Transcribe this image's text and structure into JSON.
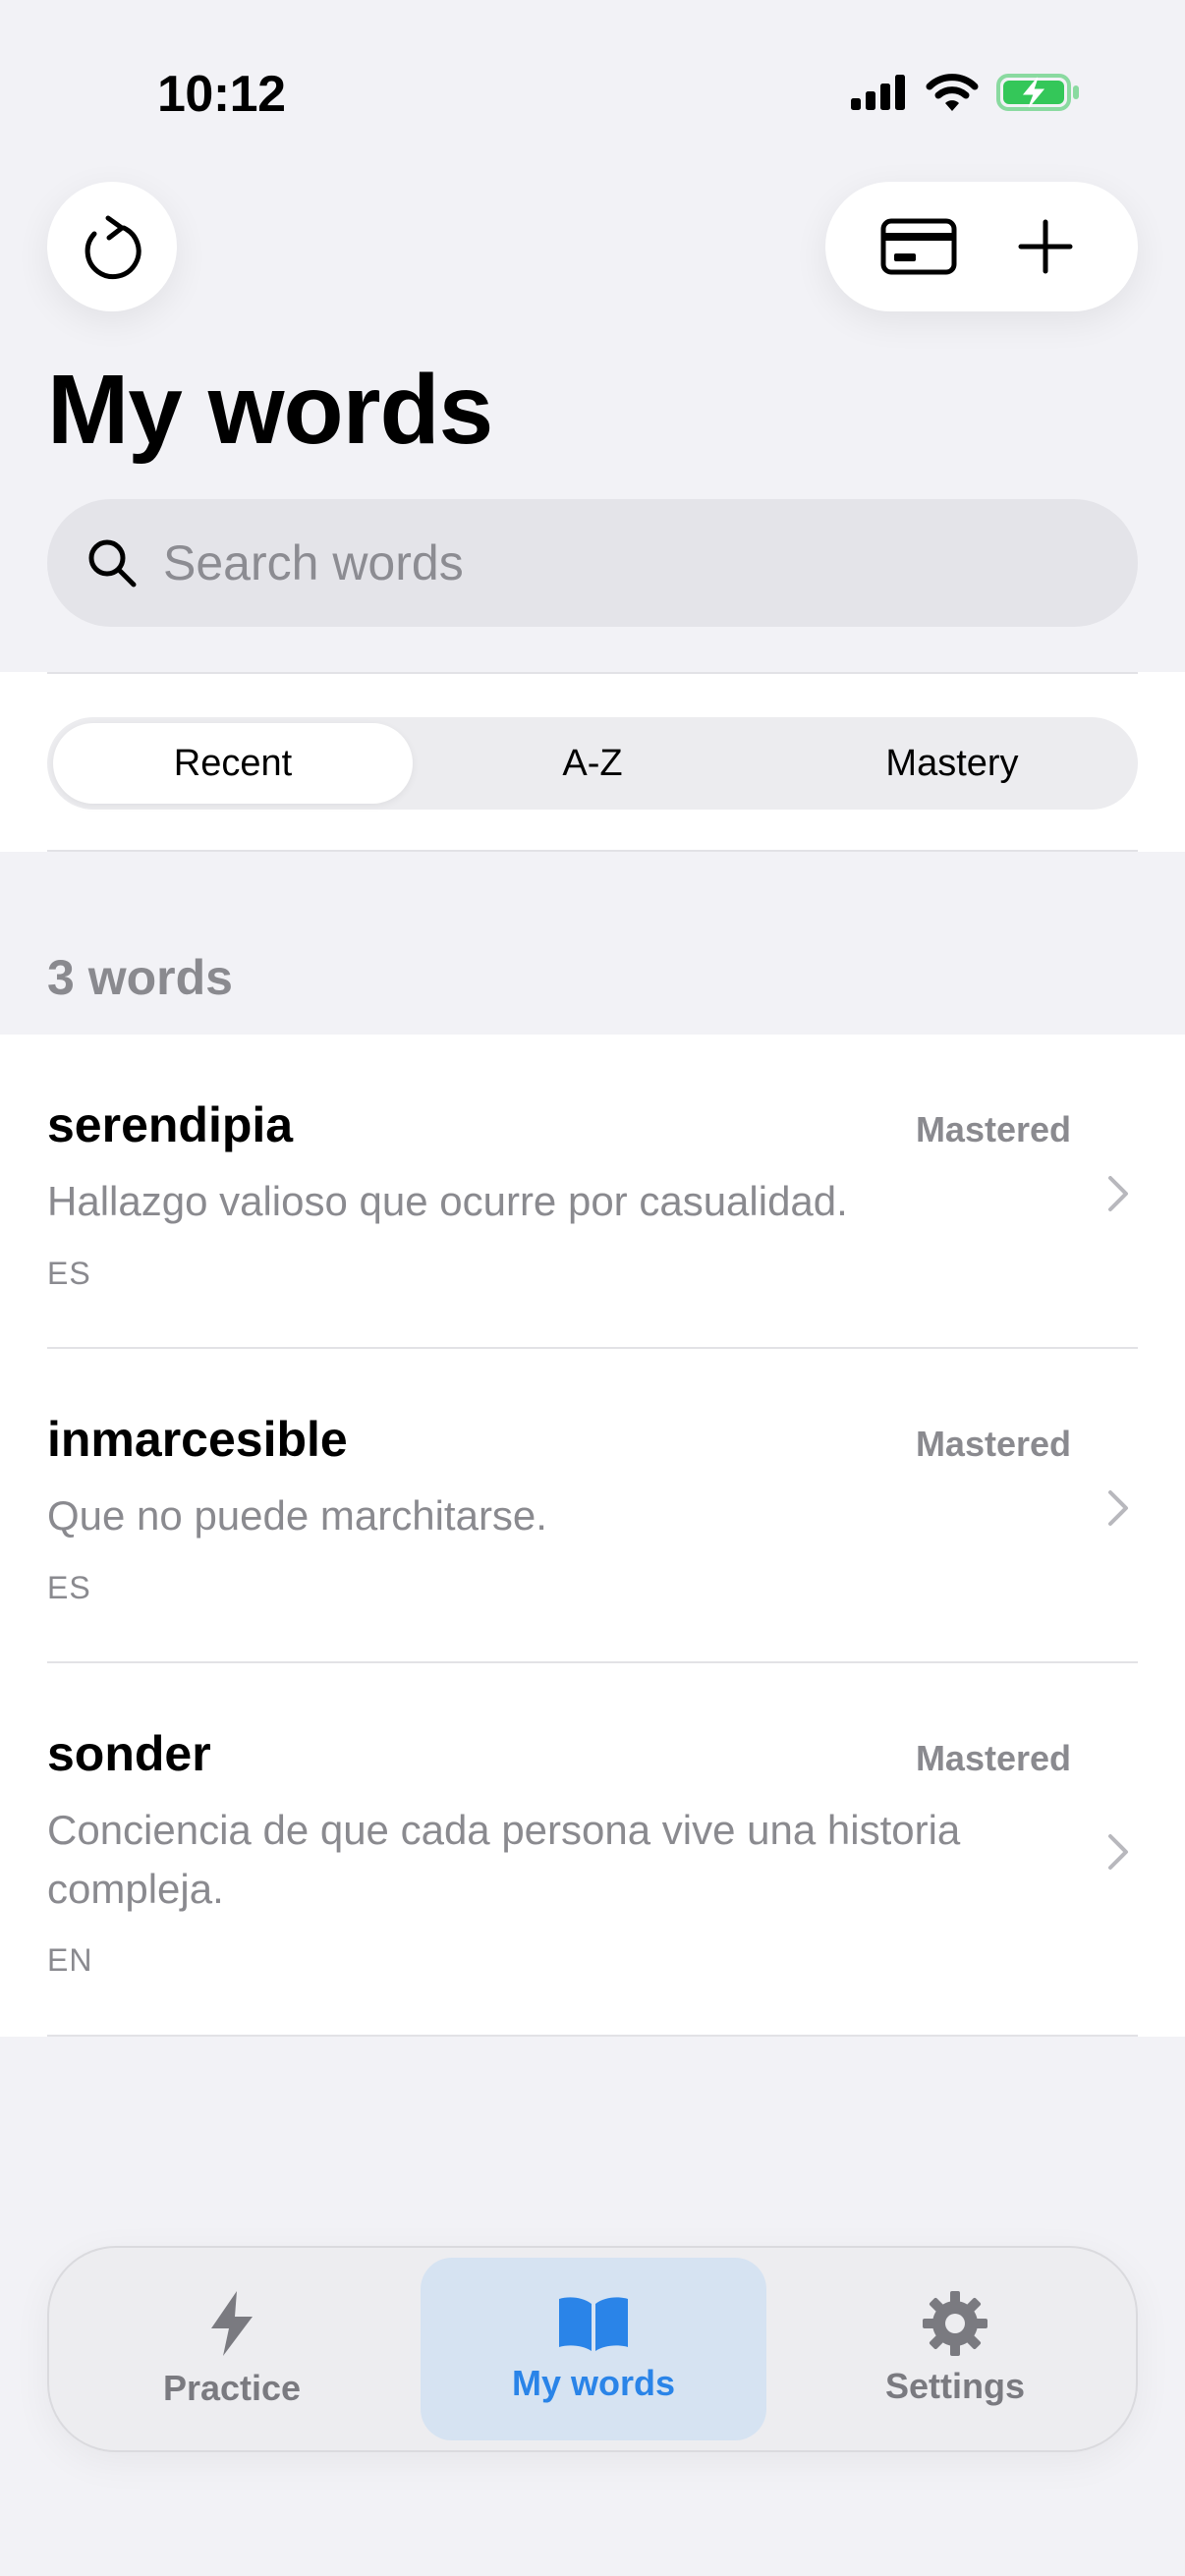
{
  "status_bar": {
    "time": "10:12"
  },
  "header": {
    "refresh_icon": "refresh-icon",
    "card_icon": "credit-card-icon",
    "add_icon": "plus-icon",
    "title": "My words"
  },
  "search": {
    "placeholder": "Search words",
    "value": ""
  },
  "sort": {
    "options": [
      "Recent",
      "A-Z",
      "Mastery"
    ],
    "selected": "Recent"
  },
  "count_label": "3 words",
  "words": [
    {
      "word": "serendipia",
      "status": "Mastered",
      "definition": "Hallazgo valioso que ocurre por casualidad.",
      "lang": "ES"
    },
    {
      "word": "inmarcesible",
      "status": "Mastered",
      "definition": "Que no puede marchitarse.",
      "lang": "ES"
    },
    {
      "word": "sonder",
      "status": "Mastered",
      "definition": "Conciencia de que cada persona vive una historia compleja.",
      "lang": "EN"
    }
  ],
  "tab_bar": {
    "tabs": [
      {
        "label": "Practice",
        "icon": "bolt-icon"
      },
      {
        "label": "My words",
        "icon": "book-icon"
      },
      {
        "label": "Settings",
        "icon": "gear-icon"
      }
    ],
    "active": "My words"
  },
  "colors": {
    "accent": "#2a84e8",
    "active_tab_bg": "#d6e3f2",
    "battery": "#34c759"
  }
}
